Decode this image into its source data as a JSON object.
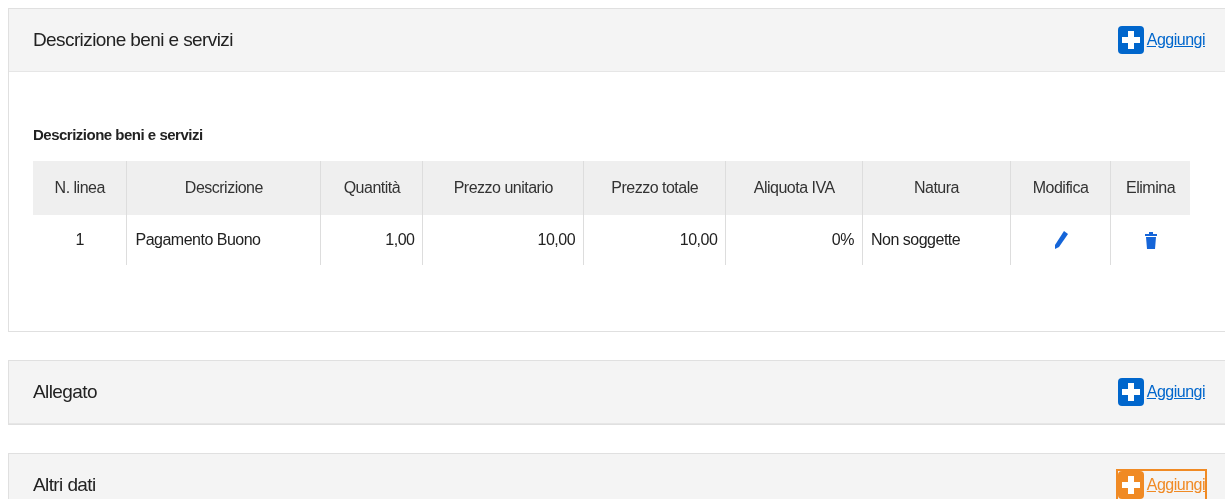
{
  "sections": [
    {
      "title": "Descrizione beni e servizi",
      "add_label": "Aggiungi",
      "highlighted": false,
      "table": {
        "caption": "Descrizione beni e servizi",
        "columns": [
          {
            "label": "N. linea",
            "kind": "center"
          },
          {
            "label": "Descrizione",
            "kind": "text"
          },
          {
            "label": "Quantità",
            "kind": "amount"
          },
          {
            "label": "Prezzo unitario",
            "kind": "amount"
          },
          {
            "label": "Prezzo totale",
            "kind": "amount"
          },
          {
            "label": "Aliquota IVA",
            "kind": "amount"
          },
          {
            "label": "Natura",
            "kind": "text"
          },
          {
            "label": "Modifica",
            "kind": "edit"
          },
          {
            "label": "Elimina",
            "kind": "delete"
          }
        ],
        "rows": [
          {
            "cells": [
              "1",
              "Pagamento Buono",
              "1,00",
              "10,00",
              "10,00",
              "0%",
              "Non soggette"
            ]
          }
        ]
      }
    },
    {
      "title": "Allegato",
      "add_label": "Aggiungi",
      "highlighted": false
    },
    {
      "title": "Altri dati",
      "add_label": "Aggiungi",
      "highlighted": true
    }
  ]
}
